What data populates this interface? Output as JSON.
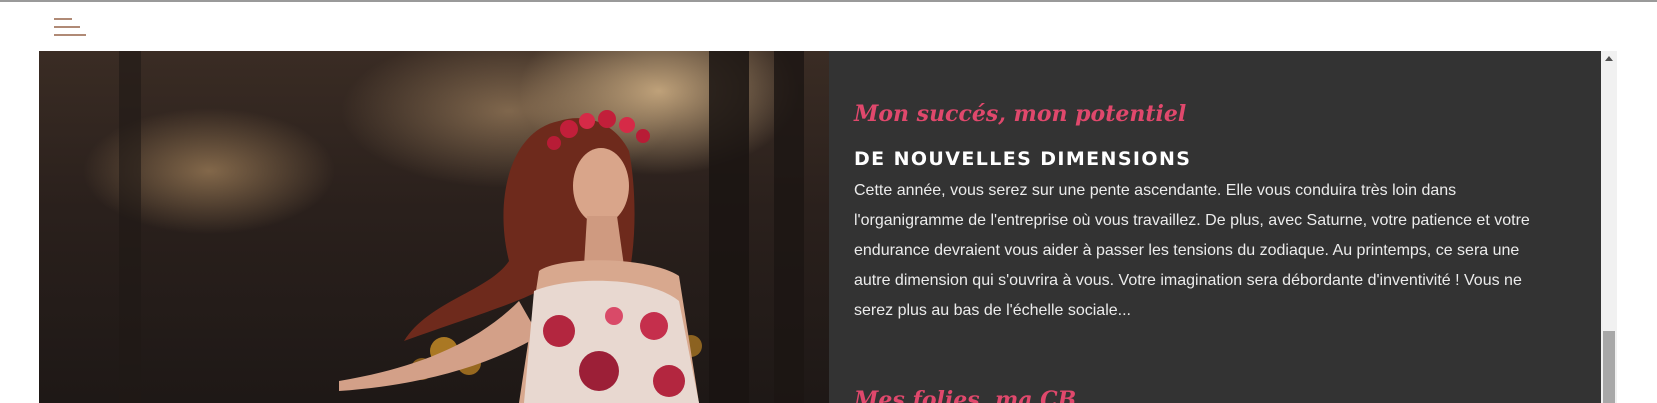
{
  "header": {
    "menu_icon": "hamburger-menu-icon"
  },
  "hero": {
    "image_description": "photo"
  },
  "sections": [
    {
      "title": "Mon succés, mon potentiel",
      "heading": "DE NOUVELLES DIMENSIONS",
      "body": "Cette année, vous serez sur une pente ascendante. Elle vous conduira très loin dans l'organigramme de l'entreprise où vous travaillez. De plus, avec Saturne, votre patience et votre endurance devraient vous aider à passer les tensions du zodiaque. Au printemps, ce sera une autre dimension qui s'ouvrira à vous. Votre imagination sera débordante d'inventivité ! Vous ne serez plus au bas de l'échelle sociale..."
    },
    {
      "title": "Mes folies, ma CB"
    }
  ],
  "colors": {
    "accent": "#e0486c",
    "panel_bg": "#333333",
    "heading_text": "#ffffff",
    "body_text": "#ececec",
    "menu_icon": "#b08a76"
  }
}
